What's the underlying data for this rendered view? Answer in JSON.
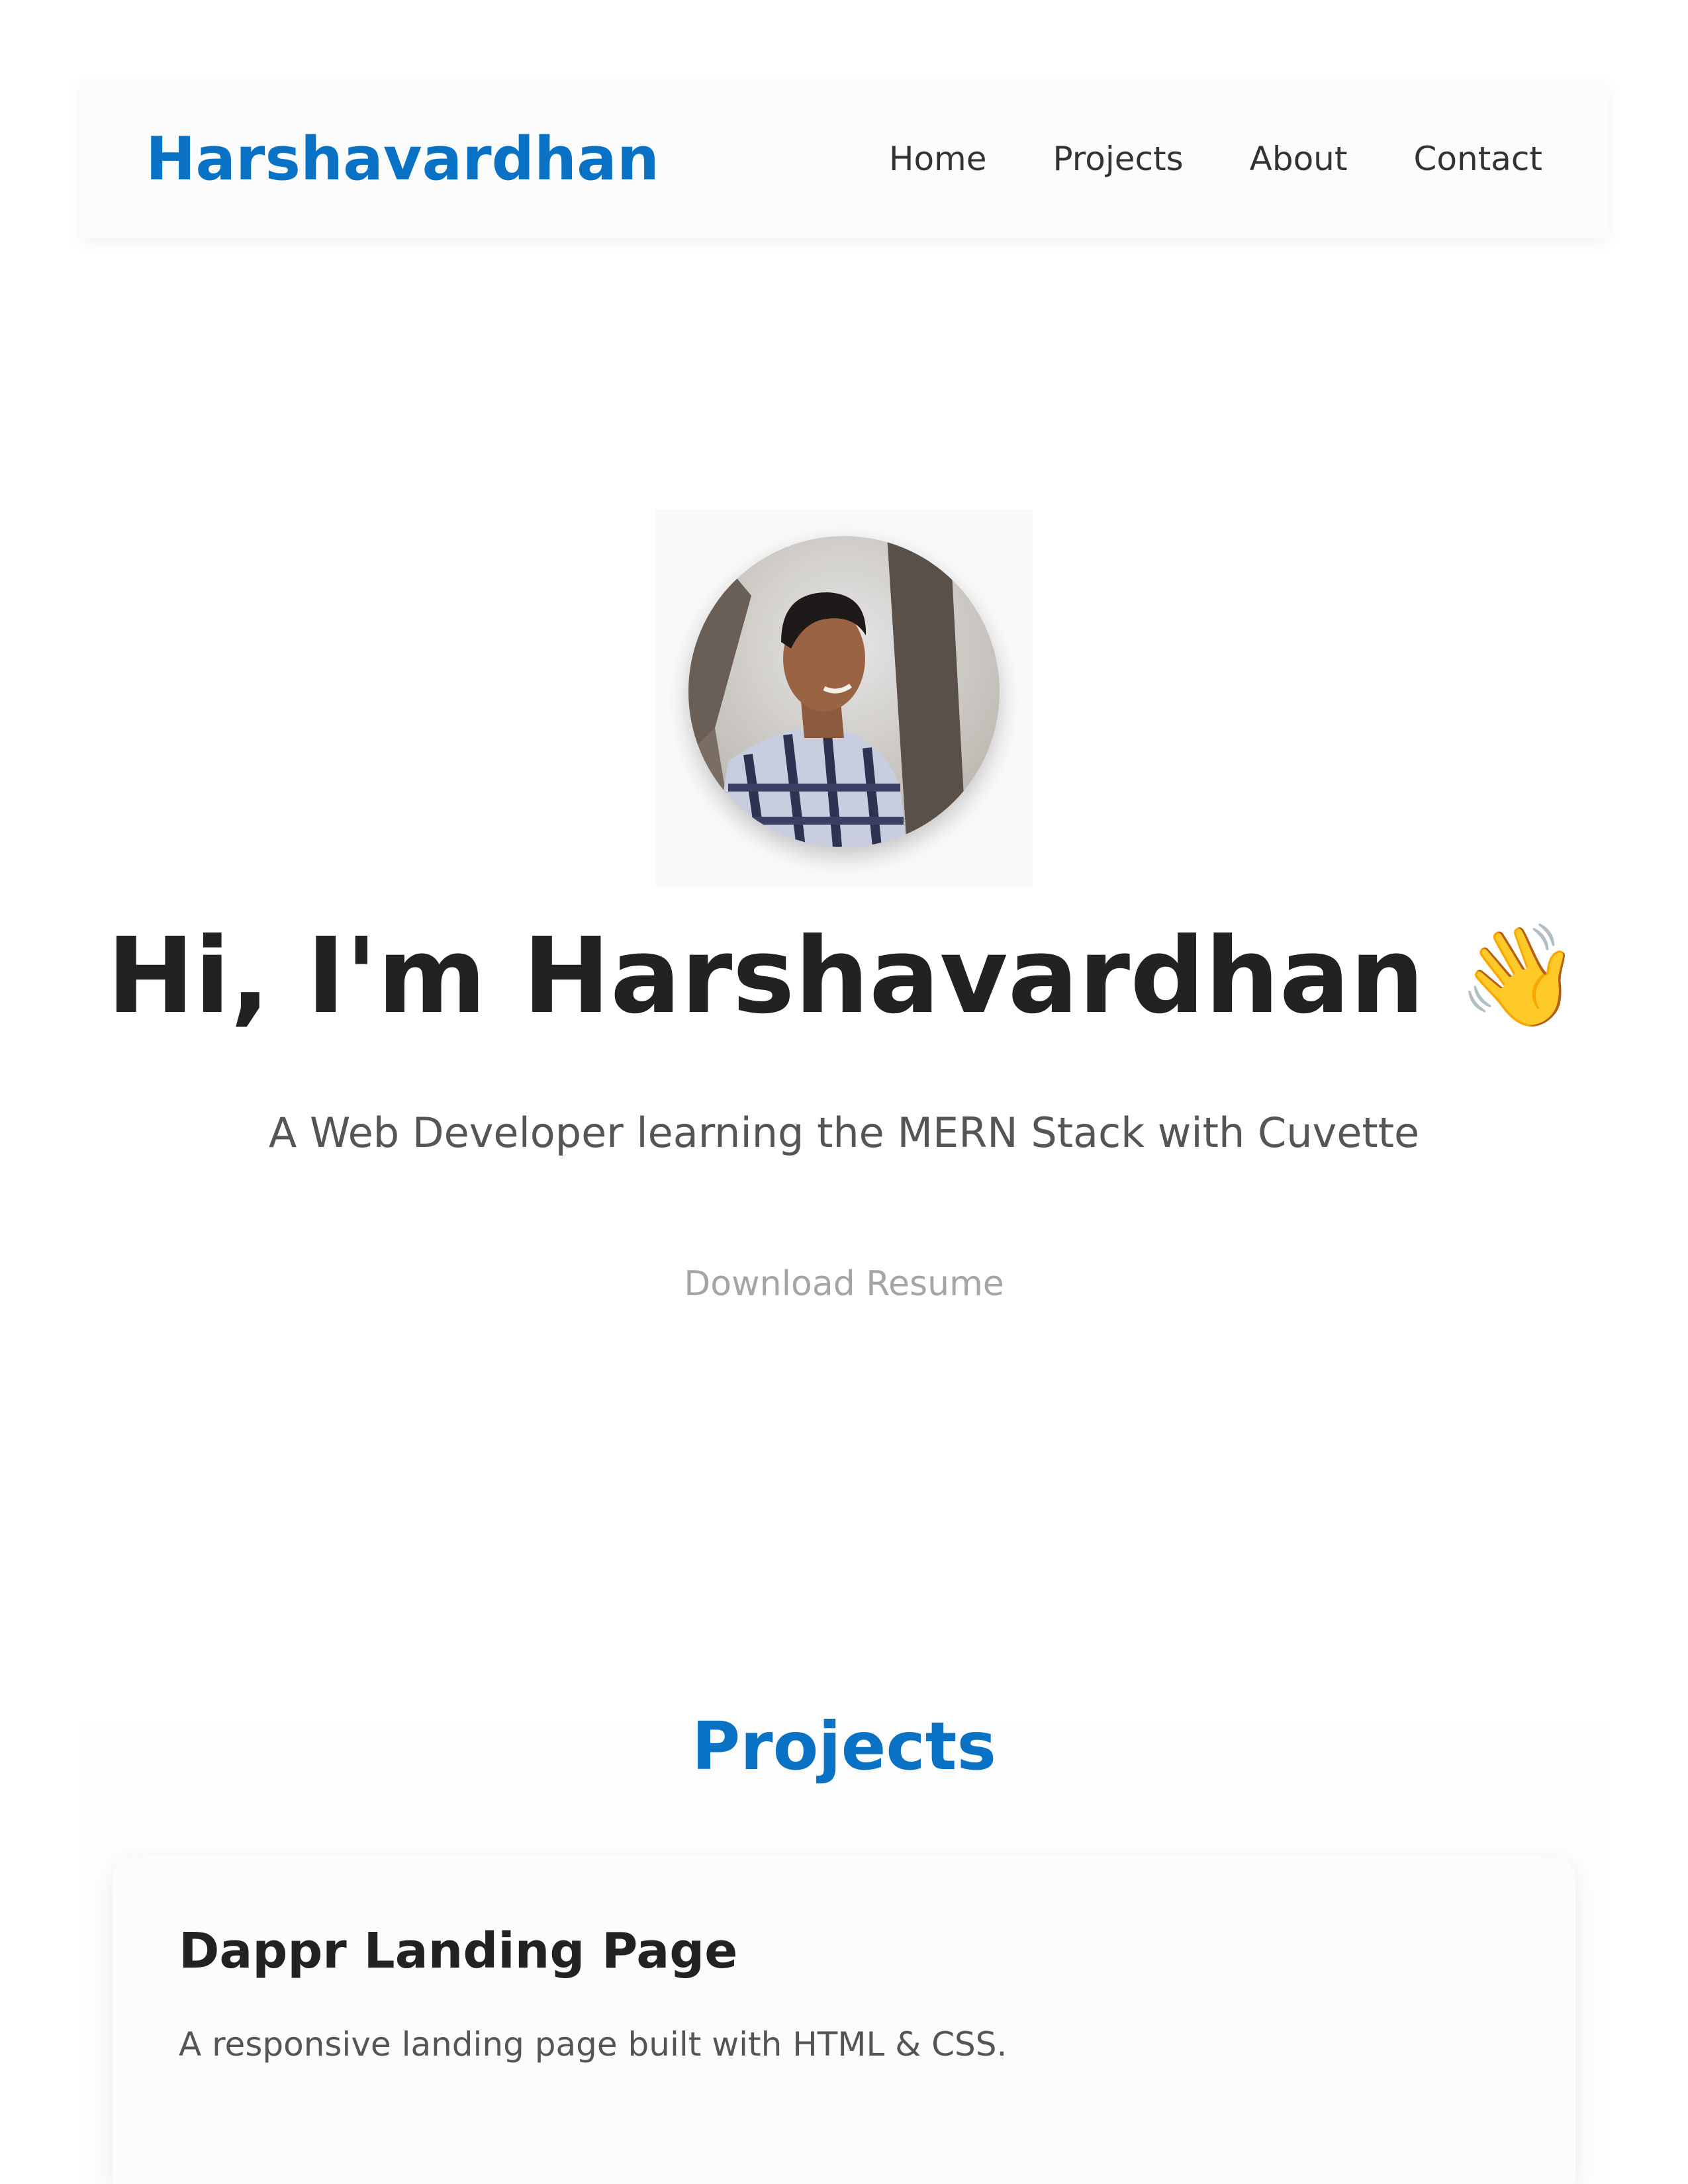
{
  "navbar": {
    "brand": "Harshavardhan",
    "links": [
      "Home",
      "Projects",
      "About",
      "Contact"
    ]
  },
  "hero": {
    "avatar_icon": "profile-photo",
    "title": "Hi, I'm Harshavardhan",
    "wave_emoji": "👋",
    "subtitle": "A Web Developer learning the MERN Stack with Cuvette",
    "resume_label": "Download Resume"
  },
  "projects": {
    "heading": "Projects",
    "items": [
      {
        "title": "Dappr Landing Page",
        "description": "A responsive landing page built with HTML & CSS."
      }
    ]
  },
  "colors": {
    "brand": "#0a72c4",
    "text": "#222222",
    "muted": "#555555",
    "link_muted": "#a5a5a5"
  }
}
